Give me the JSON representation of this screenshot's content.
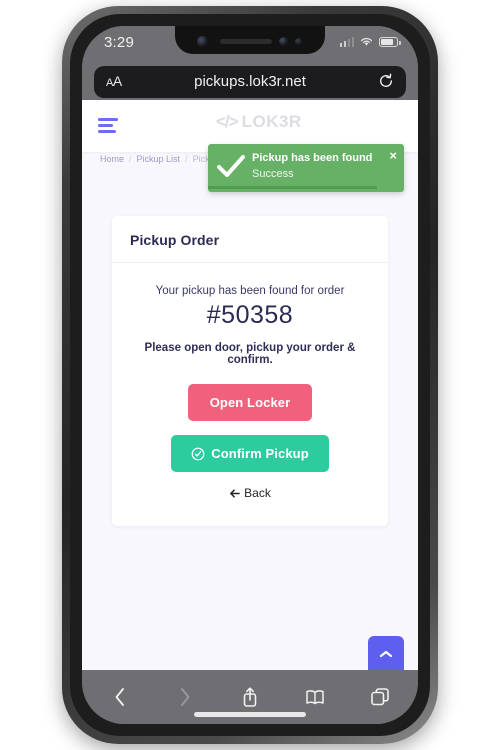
{
  "status_bar": {
    "time": "3:29",
    "signal_icon": "cellular-signal-icon",
    "wifi_icon": "wifi-icon",
    "battery_icon": "battery-icon"
  },
  "browser": {
    "text_size_label": "AA",
    "url": "pickups.lok3r.net",
    "reload_icon": "reload-icon",
    "toolbar": {
      "back_icon": "chevron-left-icon",
      "forward_icon": "chevron-right-icon",
      "share_icon": "share-icon",
      "bookmarks_icon": "book-icon",
      "tabs_icon": "tabs-icon"
    }
  },
  "site": {
    "menu_icon": "hamburger-menu-icon",
    "logo_mark": "</>",
    "logo_text": "LOK3R",
    "breadcrumb": [
      {
        "label": "Home"
      },
      {
        "label": "Pickup List"
      },
      {
        "label": "Pickup Order"
      }
    ],
    "breadcrumb_separator": "/"
  },
  "toast": {
    "title": "Pickup has been found",
    "subtitle": "Success",
    "close_label": "×",
    "check_icon": "check-mark-icon",
    "background_color": "#66b166",
    "progress_color": "#4f9e51",
    "progress_percent": 86
  },
  "card": {
    "title": "Pickup Order",
    "found_text": "Your pickup has been found for order",
    "order_number": "#50358",
    "instruction": "Please open door, pickup your order & confirm.",
    "open_locker_button": {
      "label": "Open Locker",
      "color": "#f1607c"
    },
    "confirm_button": {
      "label": "Confirm Pickup",
      "icon": "check-circle-icon",
      "color": "#2dcc9f"
    },
    "back_link": {
      "label": "Back",
      "icon": "arrow-left-icon"
    }
  },
  "floating_action": {
    "icon": "chevron-up-icon",
    "color": "#5d5fef"
  },
  "theme": {
    "page_background": "#f7f7fc",
    "card_background": "#ffffff",
    "accent_purple": "#6f6cf0",
    "heading_color": "#2b2b52"
  }
}
